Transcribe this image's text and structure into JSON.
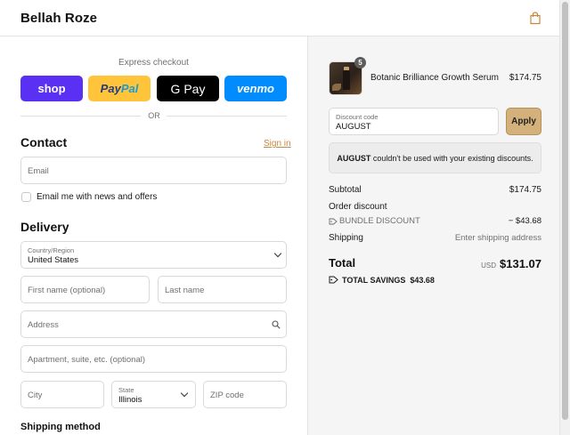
{
  "header": {
    "brand": "Bellah Roze",
    "cart_icon": "shopping-bag-icon"
  },
  "express": {
    "title": "Express checkout",
    "buttons": {
      "shop": "shop",
      "paypal_1": "Pay",
      "paypal_2": "Pal",
      "gpay": "G Pay",
      "venmo": "venmo"
    },
    "divider": "OR"
  },
  "contact": {
    "heading": "Contact",
    "sign_in": "Sign in",
    "email_placeholder": "Email",
    "newsletter_label": "Email me with news and offers"
  },
  "delivery": {
    "heading": "Delivery",
    "country_label": "Country/Region",
    "country_value": "United States",
    "first_name_placeholder": "First name (optional)",
    "last_name_placeholder": "Last name",
    "address_placeholder": "Address",
    "apartment_placeholder": "Apartment, suite, etc. (optional)",
    "city_placeholder": "City",
    "state_label": "State",
    "state_value": "Illinois",
    "zip_placeholder": "ZIP code"
  },
  "shipping_method": {
    "heading": "Shipping method"
  },
  "summary": {
    "product": {
      "name": "Botanic Brilliance Growth Serum",
      "price": "$174.75",
      "quantity": "5"
    },
    "discount_label": "Discount code",
    "discount_value": "AUGUST",
    "apply_label": "Apply",
    "notice_code": "AUGUST",
    "notice_text": " couldn't be used with your existing discounts.",
    "subtotal_label": "Subtotal",
    "subtotal_value": "$174.75",
    "order_discount_label": "Order discount",
    "bundle_label": "BUNDLE DISCOUNT",
    "bundle_value": "− $43.68",
    "shipping_label": "Shipping",
    "shipping_value": "Enter shipping address",
    "total_label": "Total",
    "total_currency": "USD",
    "total_value": "$131.07",
    "savings_label": "TOTAL SAVINGS",
    "savings_value": "$43.68"
  },
  "colors": {
    "shop_pay": "#5a31f4",
    "paypal": "#ffc439",
    "venmo": "#008cff",
    "accent": "#c4883e",
    "apply": "#d4b07a"
  }
}
